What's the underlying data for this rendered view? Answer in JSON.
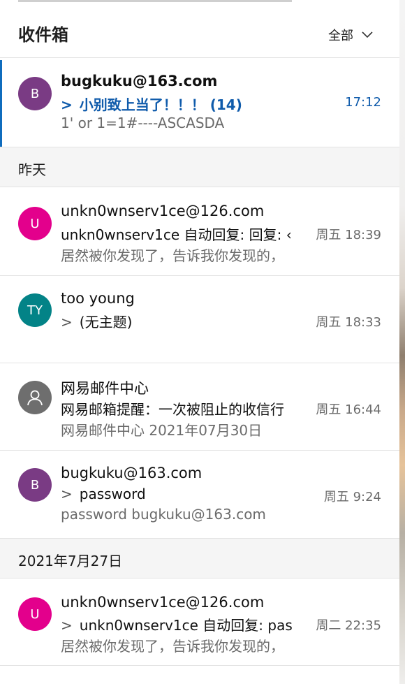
{
  "header": {
    "title": "收件箱",
    "filter_label": "全部"
  },
  "groups": {
    "yesterday": "昨天",
    "date_0727": "2021年7月27日"
  },
  "messages": [
    {
      "avatar_initials": "B",
      "avatar_color": "#7a3b84",
      "sender": "bugkuku@163.com",
      "chevron": ">",
      "subject": "小别致上当了！！！ (14)",
      "preview": "1' or 1=1#----ASCASDA",
      "time": "17:12",
      "selected": true,
      "unread": true
    },
    {
      "avatar_initials": "U",
      "avatar_color": "#e3008c",
      "sender": "unkn0wnserv1ce@126.com",
      "subject": "unkn0wnserv1ce 自动回复: 回复: ‹",
      "preview": "居然被你发现了，告诉我你发现的，",
      "time": "周五 18:39"
    },
    {
      "avatar_initials": "TY",
      "avatar_color": "#038387",
      "sender": "too young",
      "chevron": ">",
      "subject": "(无主题)",
      "preview": "",
      "time": "周五 18:33"
    },
    {
      "avatar_initials": "",
      "avatar_icon": "person-icon",
      "avatar_color": "#6e6e6e",
      "sender": "网易邮件中心",
      "subject": "网易邮箱提醒：一次被阻止的收信行",
      "preview": "网易邮件中心 2021年07月30日",
      "time": "周五 16:44"
    },
    {
      "avatar_initials": "B",
      "avatar_color": "#7a3b84",
      "sender": "bugkuku@163.com",
      "chevron": ">",
      "subject": "password",
      "preview": "password bugkuku@163.com",
      "time": "周五 9:24"
    },
    {
      "avatar_initials": "U",
      "avatar_color": "#e3008c",
      "sender": "unkn0wnserv1ce@126.com",
      "chevron": ">",
      "subject": "unkn0wnserv1ce 自动回复: pas",
      "preview": "居然被你发现了，告诉我你发现的，",
      "time": "周二 22:35"
    }
  ]
}
